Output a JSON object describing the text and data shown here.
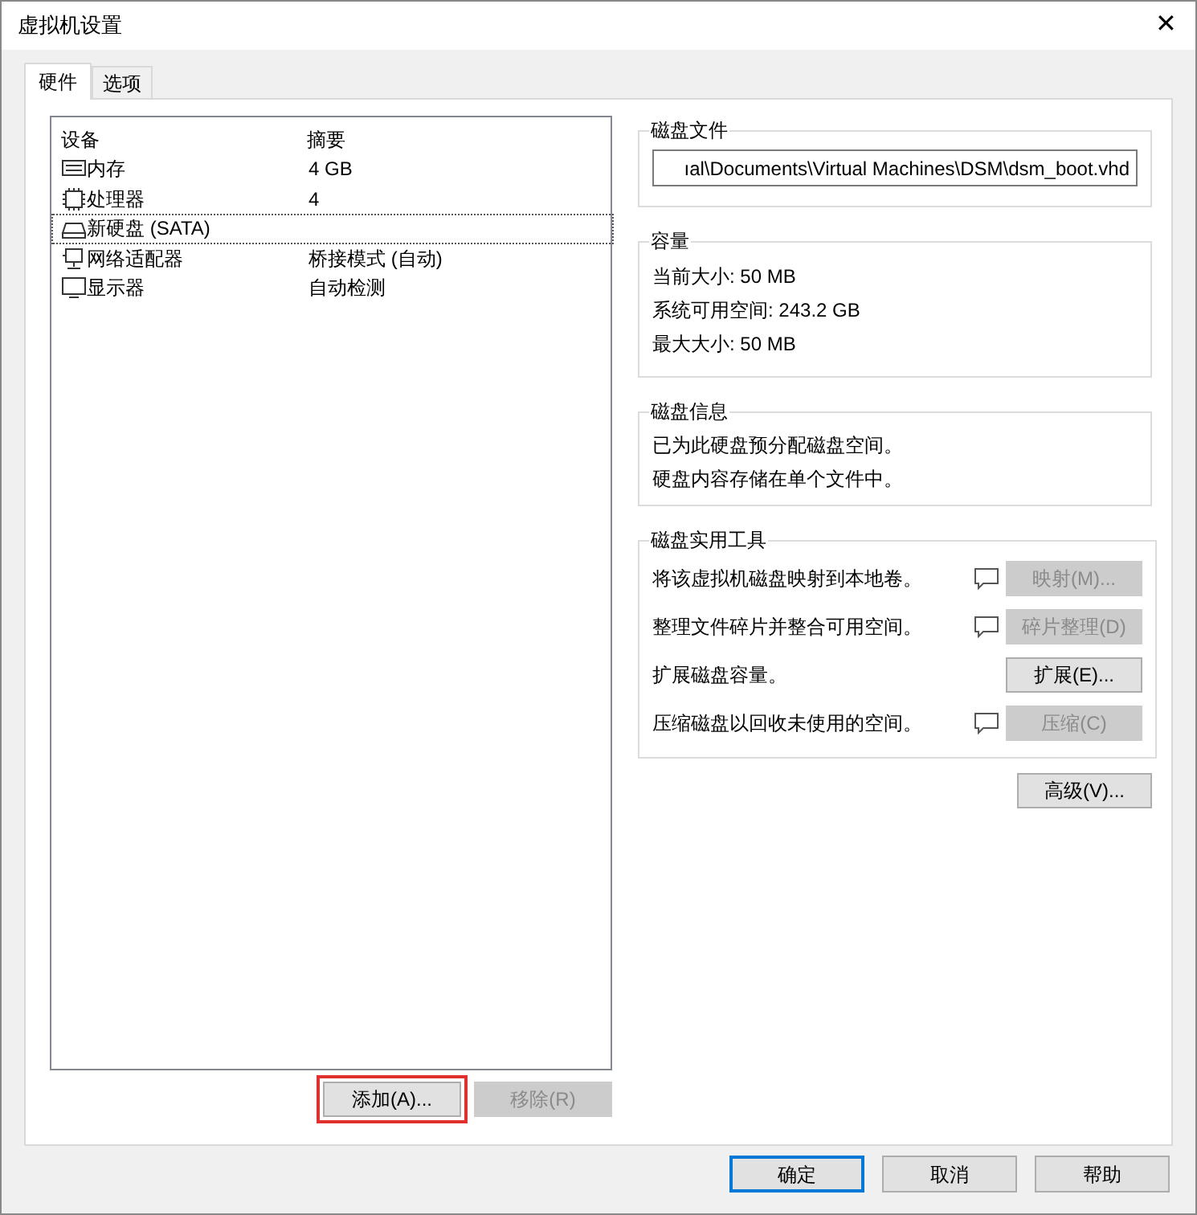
{
  "window": {
    "title": "虚拟机设置",
    "close": "✕"
  },
  "tabs": [
    {
      "label": "硬件",
      "selected": true
    },
    {
      "label": "选项",
      "selected": false
    }
  ],
  "devices": {
    "columns": [
      "设备",
      "摘要"
    ],
    "rows": [
      {
        "kind": "memory",
        "name": "内存",
        "summary": "4 GB",
        "selected": false
      },
      {
        "kind": "cpu",
        "name": "处理器",
        "summary": "4",
        "selected": false
      },
      {
        "kind": "disk",
        "name": "新硬盘 (SATA)",
        "selected": true
      },
      {
        "kind": "network",
        "name": "网络适配器",
        "summary": "桥接模式 (自动)",
        "selected": false
      },
      {
        "kind": "display",
        "name": "显示器",
        "summary": "自动检测",
        "selected": false
      }
    ]
  },
  "list_buttons": [
    {
      "label": "添加(A)...",
      "disabled": false,
      "highlighted": true
    },
    {
      "label": "移除(R)",
      "disabled": true,
      "highlighted": false
    }
  ],
  "disk_file": {
    "title": "磁盘文件",
    "value": "ıal\\Documents\\Virtual Machines\\DSM\\dsm_boot.vhd"
  },
  "capacity": {
    "title": "容量",
    "lines": [
      "当前大小: 50 MB",
      "系统可用空间: 243.2 GB",
      "最大大小: 50 MB"
    ]
  },
  "disk_info": {
    "title": "磁盘信息",
    "lines": [
      "已为此硬盘预分配磁盘空间。",
      "硬盘内容存储在单个文件中。"
    ]
  },
  "utilities": {
    "title": "磁盘实用工具",
    "rows": [
      {
        "text": "将该虚拟机磁盘映射到本地卷。",
        "info": true,
        "button": "映射(M)...",
        "disabled": true
      },
      {
        "text": "整理文件碎片并整合可用空间。",
        "info": true,
        "button": "碎片整理(D)",
        "disabled": true
      },
      {
        "text": "扩展磁盘容量。",
        "info": false,
        "button": "扩展(E)...",
        "disabled": false
      },
      {
        "text": "压缩磁盘以回收未使用的空间。",
        "info": true,
        "button": "压缩(C)",
        "disabled": true
      }
    ]
  },
  "advanced_button": "高级(V)...",
  "footer_buttons": [
    {
      "label": "确定",
      "default": true
    },
    {
      "label": "取消",
      "default": false
    },
    {
      "label": "帮助",
      "default": false
    }
  ]
}
